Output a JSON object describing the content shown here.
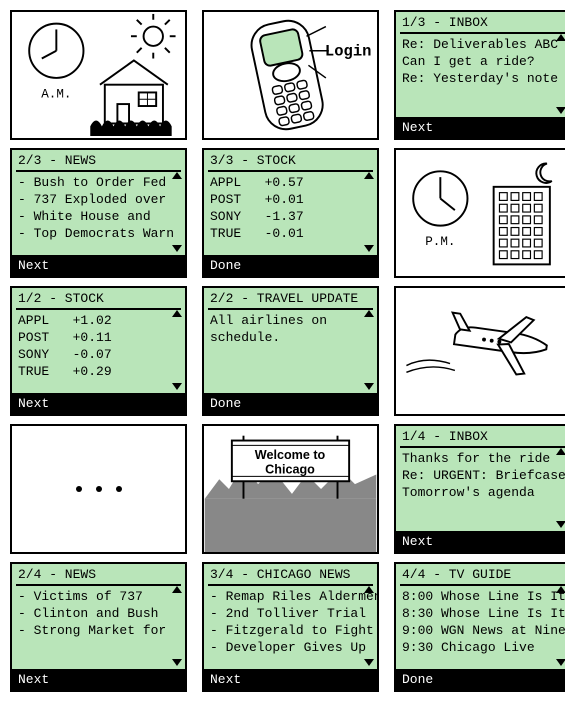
{
  "panels": {
    "am": {
      "label": "A.M."
    },
    "login": {
      "label": "Login"
    },
    "inbox1": {
      "header": "1/3 - INBOX",
      "lines": [
        "Re: Deliverables ABC",
        "Can I get a ride?",
        "Re: Yesterday's note"
      ],
      "footer": "Next"
    },
    "news1": {
      "header": "2/3 - NEWS",
      "lines": [
        "- Bush to Order Fed",
        "- 737 Exploded over",
        "- White House and",
        "- Top Democrats Warn"
      ],
      "footer": "Next"
    },
    "stock1": {
      "header": "3/3 - STOCK",
      "rows": [
        [
          "APPL",
          "+0.57"
        ],
        [
          "POST",
          "+0.01"
        ],
        [
          "SONY",
          "-1.37"
        ],
        [
          "TRUE",
          "-0.01"
        ]
      ],
      "footer": "Done"
    },
    "pm": {
      "label": "P.M."
    },
    "stock2": {
      "header": "1/2 - STOCK",
      "rows": [
        [
          "APPL",
          "+1.02"
        ],
        [
          "POST",
          "+0.11"
        ],
        [
          "SONY",
          "-0.07"
        ],
        [
          "TRUE",
          "+0.29"
        ]
      ],
      "footer": "Next"
    },
    "travel": {
      "header": "2/2 - TRAVEL UPDATE",
      "lines": [
        "All airlines on",
        "schedule."
      ],
      "footer": "Done"
    },
    "welcome": {
      "line1": "Welcome to",
      "line2": "Chicago"
    },
    "inbox2": {
      "header": "1/4 - INBOX",
      "lines": [
        "Thanks for the ride",
        "Re: URGENT: Briefcase",
        "Tomorrow's agenda"
      ],
      "footer": "Next"
    },
    "news2": {
      "header": "2/4 - NEWS",
      "lines": [
        "- Victims of 737",
        "- Clinton and Bush",
        "- Strong Market for"
      ],
      "footer": "Next"
    },
    "chicago": {
      "header": "3/4 - CHICAGO NEWS",
      "lines": [
        "- Remap Riles Aldermen",
        "- 2nd Tolliver Trial",
        "- Fitzgerald to Fight",
        "- Developer Gives Up"
      ],
      "footer": "Next"
    },
    "tv": {
      "header": "4/4 - TV GUIDE",
      "lines": [
        "8:00 Whose Line Is It",
        "8:30 Whose Line Is It",
        "9:00 WGN News at Nine",
        "9:30 Chicago Live"
      ],
      "footer": "Done"
    }
  }
}
